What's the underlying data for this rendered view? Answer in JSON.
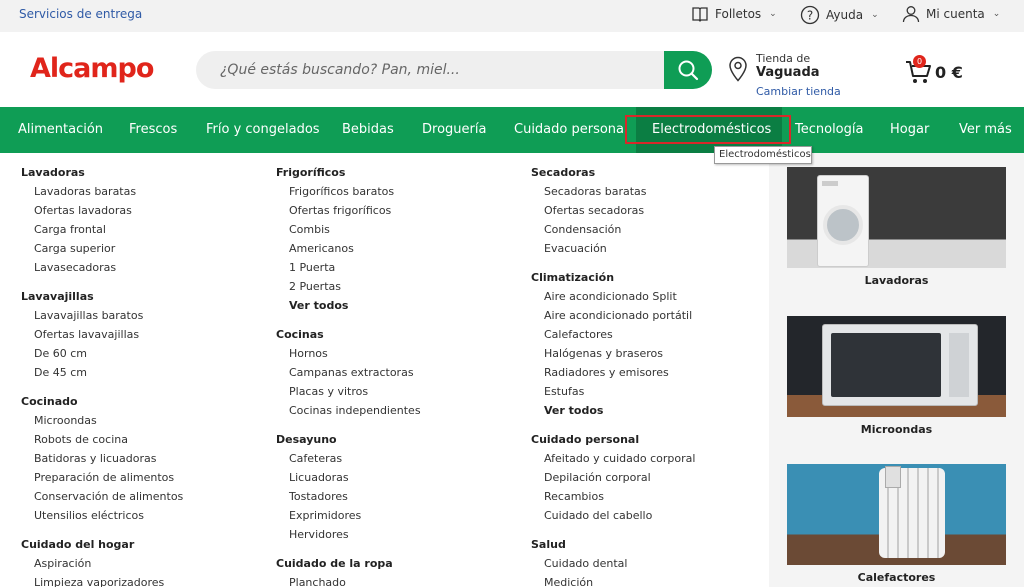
{
  "topbar": {
    "services": "Servicios de entrega",
    "folletos": "Folletos",
    "ayuda": "Ayuda",
    "cuenta": "Mi cuenta"
  },
  "header": {
    "logo": "Alcampo",
    "search_placeholder": "¿Qué estás buscando? Pan, miel...",
    "store_label": "Tienda de",
    "store_name": "Vaguada",
    "store_change": "Cambiar tienda",
    "cart_count": "0",
    "cart_amount": "0 €"
  },
  "nav": {
    "items": [
      "Alimentación",
      "Frescos",
      "Frío y congelados",
      "Bebidas",
      "Droguería",
      "Cuidado personal",
      "Electrodomésticos",
      "Tecnología",
      "Hogar",
      "Ver más"
    ],
    "tooltip": "Electrodomésticos"
  },
  "menu": {
    "col1": [
      {
        "title": "Lavadoras",
        "items": [
          "Lavadoras baratas",
          "Ofertas lavadoras",
          "Carga frontal",
          "Carga superior",
          "Lavasecadoras"
        ]
      },
      {
        "title": "Lavavajillas",
        "items": [
          "Lavavajillas baratos",
          "Ofertas lavavajillas",
          "De 60 cm",
          "De 45 cm"
        ]
      },
      {
        "title": "Cocinado",
        "items": [
          "Microondas",
          "Robots de cocina",
          "Batidoras y licuadoras",
          "Preparación de alimentos",
          "Conservación de alimentos",
          "Utensilios eléctricos"
        ]
      },
      {
        "title": "Cuidado del hogar",
        "items": [
          "Aspiración",
          "Limpieza vaporizadores"
        ]
      }
    ],
    "col2": [
      {
        "title": "Frigoríficos",
        "items": [
          "Frigoríficos baratos",
          "Ofertas frigoríficos",
          "Combis",
          "Americanos",
          "1 Puerta",
          "2 Puertas"
        ],
        "more": "Ver todos"
      },
      {
        "title": "Cocinas",
        "items": [
          "Hornos",
          "Campanas extractoras",
          "Placas y vitros",
          "Cocinas independientes"
        ]
      },
      {
        "title": "Desayuno",
        "items": [
          "Cafeteras",
          "Licuadoras",
          "Tostadores",
          "Exprimidores",
          "Hervidores"
        ]
      },
      {
        "title": "Cuidado de la ropa",
        "items": [
          "Planchado"
        ]
      }
    ],
    "col3": [
      {
        "title": "Secadoras",
        "items": [
          "Secadoras baratas",
          "Ofertas secadoras",
          "Condensación",
          "Evacuación"
        ]
      },
      {
        "title": "Climatización",
        "items": [
          "Aire acondicionado Split",
          "Aire acondicionado portátil",
          "Calefactores",
          "Halógenas y braseros",
          "Radiadores y emisores",
          "Estufas"
        ],
        "more": "Ver todos"
      },
      {
        "title": "Cuidado personal",
        "items": [
          "Afeitado y cuidado corporal",
          "Depilación corporal",
          "Recambios",
          "Cuidado del cabello"
        ]
      },
      {
        "title": "Salud",
        "items": [
          "Cuidado dental",
          "Medición"
        ]
      }
    ]
  },
  "promos": [
    "Lavadoras",
    "Microondas",
    "Calefactores"
  ],
  "colors": {
    "green": "#0f9d55",
    "dark_green": "#0b7e43",
    "red": "#e0251b",
    "link_blue": "#2f5aa6"
  }
}
